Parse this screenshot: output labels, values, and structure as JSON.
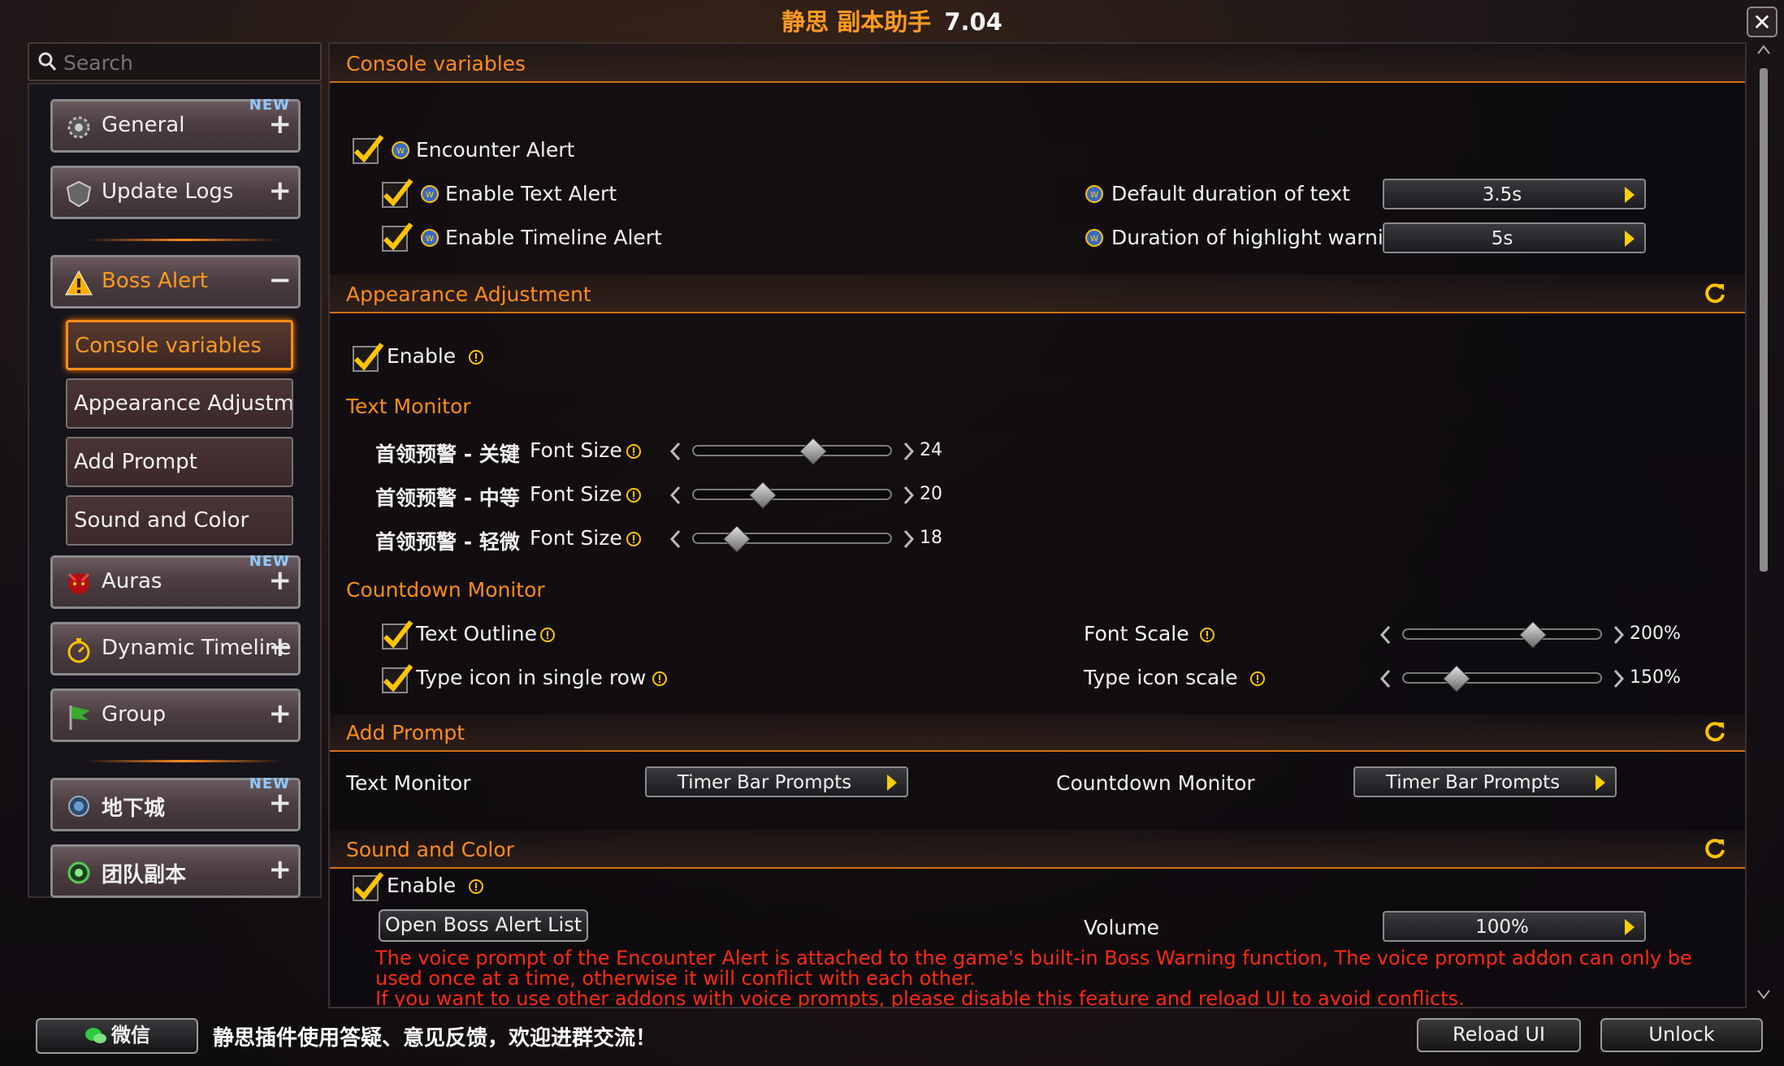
{
  "window": {
    "title_cn": "静思 副本助手",
    "version": "7.04"
  },
  "search": {
    "placeholder": "Search"
  },
  "sidebar": {
    "general": {
      "label": "General",
      "badge": "NEW"
    },
    "update_logs": {
      "label": "Update Logs"
    },
    "boss_alert": {
      "label": "Boss Alert"
    },
    "sub_items": [
      "Console variables",
      "Appearance Adjustm...",
      "Add Prompt",
      "Sound and Color"
    ],
    "auras": {
      "label": "Auras",
      "badge": "NEW"
    },
    "dynamic_timeline": {
      "label": "Dynamic Timeline"
    },
    "group": {
      "label": "Group"
    },
    "dungeon": {
      "label": "地下城",
      "badge": "NEW"
    },
    "raid": {
      "label": "团队副本"
    }
  },
  "console": {
    "header": "Console variables",
    "encounter_alert": "Encounter Alert",
    "enable_text_alert": "Enable Text Alert",
    "enable_timeline_alert": "Enable Timeline Alert",
    "default_duration_label": "Default duration of text",
    "default_duration_value": "3.5s",
    "highlight_duration_label": "Duration of highlight warnin",
    "highlight_duration_value": "5s"
  },
  "appearance": {
    "header": "Appearance Adjustment",
    "enable": "Enable",
    "text_monitor": "Text Monitor",
    "font_rows": [
      {
        "cn": "首领预警 - 关键",
        "en": "Font Size",
        "value": "24",
        "pos": 0.6
      },
      {
        "cn": "首领预警 - 中等",
        "en": "Font Size",
        "value": "20",
        "pos": 0.35
      },
      {
        "cn": "首领预警 - 轻微",
        "en": "Font Size",
        "value": "18",
        "pos": 0.22
      }
    ],
    "countdown_monitor": "Countdown Monitor",
    "text_outline": "Text Outline",
    "type_icon_single_row": "Type icon in single row",
    "font_scale": {
      "label": "Font Scale",
      "value": "200%",
      "pos": 0.65
    },
    "type_icon_scale": {
      "label": "Type icon scale",
      "value": "150%",
      "pos": 0.27
    }
  },
  "add_prompt": {
    "header": "Add Prompt",
    "text_monitor": "Text Monitor",
    "text_monitor_value": "Timer Bar Prompts",
    "countdown_monitor": "Countdown Monitor",
    "countdown_monitor_value": "Timer Bar Prompts"
  },
  "sound_color": {
    "header": "Sound and Color",
    "enable": "Enable",
    "open_list": "Open Boss Alert List",
    "volume_label": "Volume",
    "volume_value": "100%",
    "note_1": "The voice prompt of the Encounter Alert is attached to the game's built-in Boss Warning function, The voice prompt addon can only be",
    "note_2": "used once at a time, otherwise it will conflict with each other.",
    "note_3": "If you want to use other addons with voice prompts, please disable this feature and reload UI to avoid conflicts."
  },
  "footer": {
    "wechat": "微信",
    "text": "静思插件使用答疑、意见反馈，欢迎进群交流！",
    "reload": "Reload UI",
    "unlock": "Unlock"
  },
  "colors": {
    "accent": "#ff9a1f",
    "warning_text": "#ff2a10",
    "badge": "#8ec8ff"
  }
}
